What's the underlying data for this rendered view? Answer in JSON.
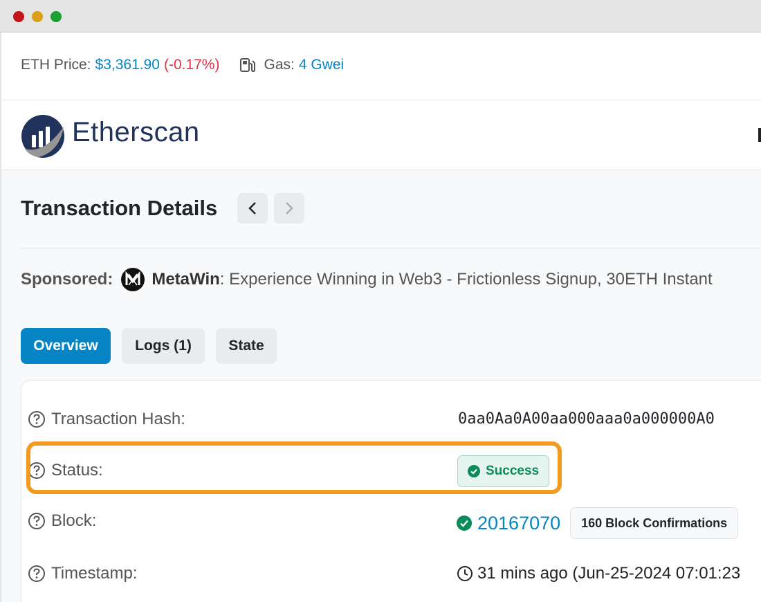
{
  "infobar": {
    "eth_price_label": "ETH Price:",
    "eth_price_value": "$3,361.90",
    "eth_price_change": "(-0.17%)",
    "gas_label": "Gas:",
    "gas_value": "4 Gwei"
  },
  "header": {
    "logo_text": "Etherscan"
  },
  "page": {
    "title": "Transaction Details"
  },
  "sponsored": {
    "label": "Sponsored:",
    "brand": "MetaWin",
    "text": ": Experience Winning in Web3 - Frictionless Signup, 30ETH Instant"
  },
  "tabs": [
    {
      "label": "Overview",
      "active": true
    },
    {
      "label": "Logs (1)",
      "active": false
    },
    {
      "label": "State",
      "active": false
    }
  ],
  "details": {
    "hash_label": "Transaction Hash:",
    "hash_value": "0aa0Aa0A00aa000aaa0a000000A0",
    "status_label": "Status:",
    "status_value": "Success",
    "block_label": "Block:",
    "block_value": "20167070",
    "block_confirmations": "160 Block Confirmations",
    "timestamp_label": "Timestamp:",
    "timestamp_value": "31 mins ago (Jun-25-2024 07:01:23"
  },
  "colors": {
    "link_blue": "#0784c3",
    "negative_red": "#dc3545",
    "success_green": "#0b8a5a",
    "highlight_orange": "#f19a20"
  }
}
